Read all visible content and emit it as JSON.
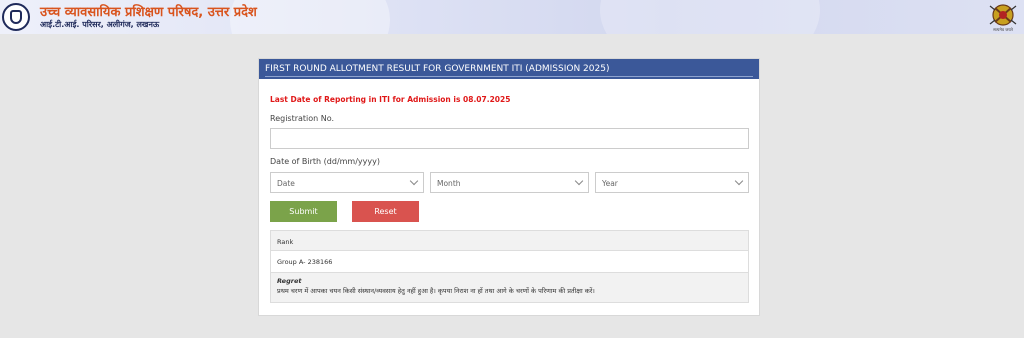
{
  "header": {
    "org_title": "उच्च व्यावसायिक प्रशिक्षण परिषद, उत्तर प्रदेश",
    "org_subtitle": "आई.टी.आई. परिसर, अलीगंज, लखनऊ",
    "right_logo_caption": "सत्यमेव जयते",
    "bg_color": "#dfe3f5",
    "title_color": "#d9541e"
  },
  "card": {
    "title": "FIRST ROUND ALLOTMENT RESULT FOR GOVERNMENT ITI (ADMISSION 2025)",
    "header_color": "#3b5899",
    "notice": "Last Date of Reporting in ITI for Admission is 08.07.2025",
    "notice_color": "#e01818"
  },
  "form": {
    "registration_label": "Registration No.",
    "registration_value": "",
    "dob_label": "Date of Birth (dd/mm/yyyy)",
    "date_select": "Date",
    "month_select": "Month",
    "year_select": "Year",
    "submit_label": "Submit",
    "submit_color": "#7ba34a",
    "reset_label": "Reset",
    "reset_color": "#d9534f"
  },
  "result": {
    "rank_label": "Rank",
    "group_value": "Group A- 238166",
    "regret_title": "Regret",
    "regret_message": "प्रथम चरण में आपका चयन किसी संस्थान/व्यवसाय हेतु नहीं हुआ है। कृपया निराश ना हों तथा आगे के चरणों के परिणाम की प्रतीक्षा करें।"
  }
}
